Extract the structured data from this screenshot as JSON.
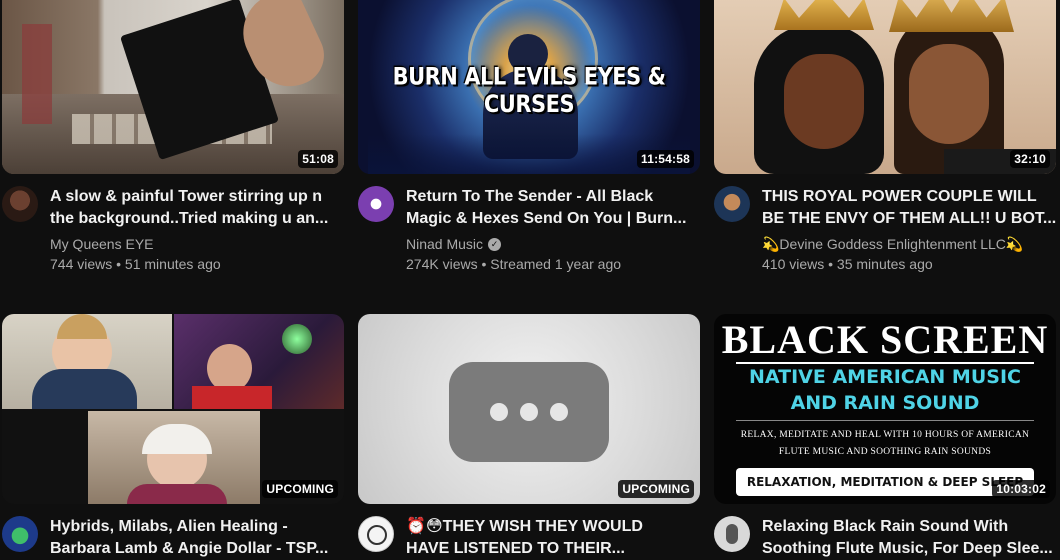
{
  "videos": [
    {
      "title_lines": [
        "A slow & painful Tower stirring up n",
        "the background..Tried making u an..."
      ],
      "channel": "My Queens EYE",
      "stats": "744 views • 51 minutes ago",
      "duration": "51:08"
    },
    {
      "title_lines": [
        "Return To The Sender - All Black",
        "Magic & Hexes Send On You | Burn..."
      ],
      "channel": "Ninad Music",
      "verified": true,
      "stats": "274K views • Streamed 1 year ago",
      "duration": "11:54:58",
      "thumb_text": "BURN ALL EVILS EYES & CURSES"
    },
    {
      "title_lines": [
        "THIS ROYAL POWER COUPLE WILL",
        "BE THE ENVY OF THEM ALL!! U BOT..."
      ],
      "channel": "💫Devine Goddess Enlightenment LLC💫",
      "stats": "410 views • 35 minutes ago",
      "duration": "32:10"
    },
    {
      "title_lines": [
        "Hybrids, Milabs, Alien Healing -",
        "Barbara Lamb & Angie Dollar - TSP..."
      ],
      "duration": "UPCOMING"
    },
    {
      "title_lines": [
        "⏰😳THEY WISH THEY WOULD",
        "HAVE LISTENED TO THEIR..."
      ],
      "duration": "UPCOMING"
    },
    {
      "title_lines": [
        "Relaxing Black Rain Sound With",
        "Soothing Flute Music, For Deep Slee..."
      ],
      "duration": "10:03:02",
      "thumb": {
        "heading": "BLACK SCREEN",
        "sub1": "NATIVE AMERICAN MUSIC",
        "sub2": "AND RAIN SOUND",
        "desc1": "RELAX, MEDITATE AND HEAL WITH 10 HOURS OF AMERICAN",
        "desc2": "FLUTE MUSIC AND SOOTHING RAIN SOUNDS",
        "banner": "RELAXATION, MEDITATION & DEEP SLEEP"
      }
    }
  ],
  "colors": {
    "background": "#0f0f0f",
    "title": "#f1f1f1",
    "secondary": "#aaaaaa",
    "accent_cyan": "#4fd3e6"
  }
}
